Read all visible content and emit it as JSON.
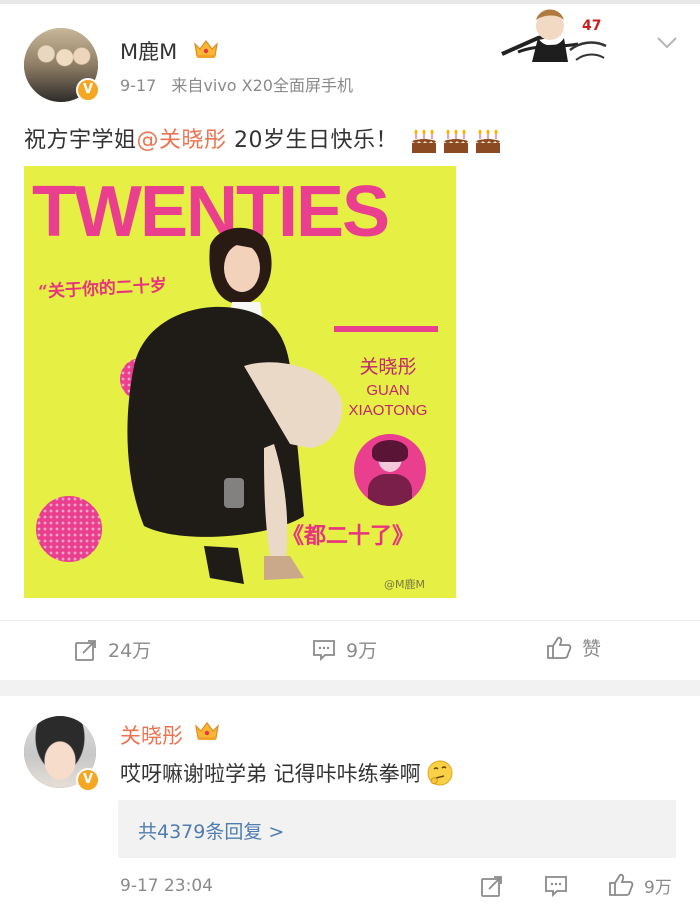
{
  "post": {
    "username": "M鹿M",
    "date": "9-17",
    "source": "来自vivo X20全面屏手机",
    "text_prefix": "祝方宇学姐",
    "mention": "@关晓彤",
    "text_suffix": " 20岁生日快乐！",
    "cake_icons": [
      "cake-icon",
      "cake-icon",
      "cake-icon"
    ]
  },
  "poster": {
    "title": "TWENTIES",
    "subtitle": "“关于你的二十岁",
    "name_cn": "关晓彤",
    "name_en_1": "GUAN",
    "name_en_2": "XIAOTONG",
    "tagline": "《都二十了》",
    "watermark": "@M鹿M"
  },
  "actions": {
    "repost_count": "24万",
    "comment_count": "9万",
    "like_label": "赞"
  },
  "comment": {
    "username": "关晓彤",
    "text": "哎呀嘛谢啦学弟 记得咔咔练拳啊",
    "reply_link": "共4379条回复 >",
    "time": "9-17 23:04",
    "like_count": "9万"
  },
  "colors": {
    "accent_orange": "#eb7350",
    "link_blue": "#507daf",
    "poster_yellow": "#e6ef44",
    "poster_pink": "#ea3f8f"
  }
}
